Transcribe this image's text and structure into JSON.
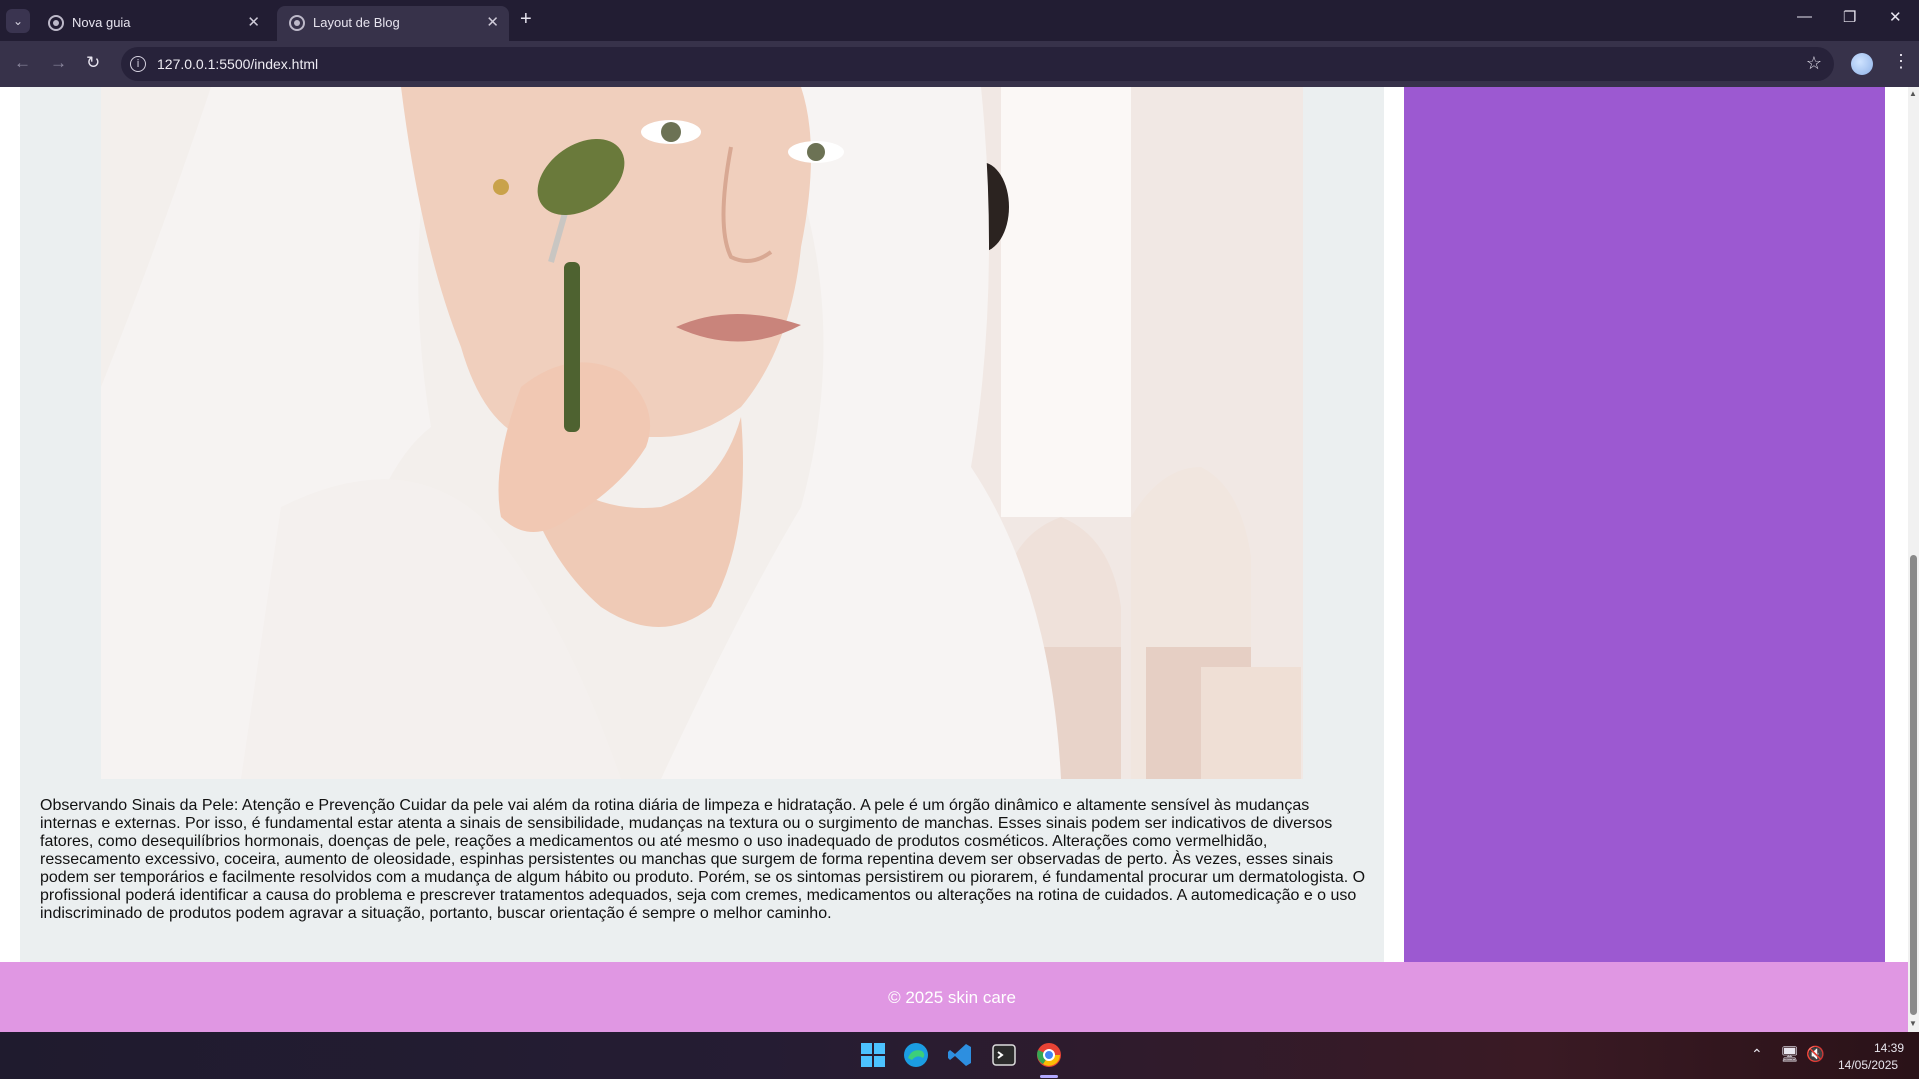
{
  "browser": {
    "tabs": [
      {
        "title": "Nova guia",
        "active": false
      },
      {
        "title": "Layout de Blog",
        "active": true
      }
    ],
    "url": "127.0.0.1:5500/index.html"
  },
  "icons": {
    "tab_search": "chevron-down-icon",
    "new_tab": "plus-icon",
    "back": "arrow-left-icon",
    "forward": "arrow-right-icon",
    "reload": "reload-icon",
    "site_info": "info-icon",
    "bookmark": "star-icon",
    "menu": "kebab-menu-icon"
  },
  "article": {
    "image_alt": "Woman in white bathrobe using a green jade facial roller",
    "text": "Observando Sinais da Pele: Atenção e Prevenção Cuidar da pele vai além da rotina diária de limpeza e hidratação. A pele é um órgão dinâmico e altamente sensível às mudanças internas e externas. Por isso, é fundamental estar atenta a sinais de sensibilidade, mudanças na textura ou o surgimento de manchas. Esses sinais podem ser indicativos de diversos fatores, como desequilíbrios hormonais, doenças de pele, reações a medicamentos ou até mesmo o uso inadequado de produtos cosméticos. Alterações como vermelhidão, ressecamento excessivo, coceira, aumento de oleosidade, espinhas persistentes ou manchas que surgem de forma repentina devem ser observadas de perto. Às vezes, esses sinais podem ser temporários e facilmente resolvidos com a mudança de algum hábito ou produto. Porém, se os sintomas persistirem ou piorarem, é fundamental procurar um dermatologista. O profissional poderá identificar a causa do problema e prescrever tratamentos adequados, seja com cremes, medicamentos ou alterações na rotina de cuidados. A automedicação e o uso indiscriminado de produtos podem agravar a situação, portanto, buscar orientação é sempre o melhor caminho."
  },
  "footer": {
    "text": "© 2025 skin care"
  },
  "colors": {
    "sidebar": "#9c59d1",
    "footer": "#e097e3",
    "card": "#ebeff0"
  },
  "taskbar": {
    "time": "14:39",
    "date": "14/05/2025"
  }
}
